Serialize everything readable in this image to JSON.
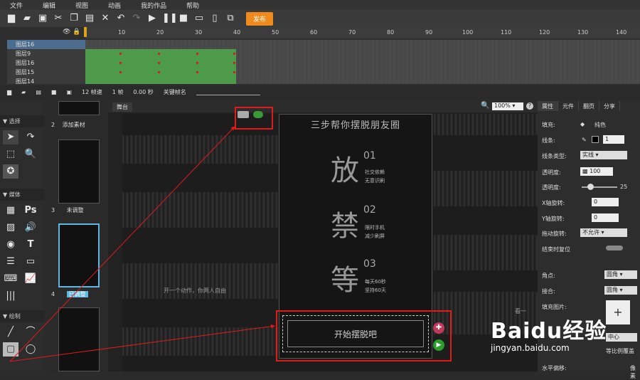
{
  "menu": [
    "文件",
    "编辑",
    "视图",
    "动画",
    "我的作品",
    "帮助"
  ],
  "toolbar": {
    "publish_label": "发布"
  },
  "timeline": {
    "ticks": [
      "10",
      "20",
      "30",
      "40",
      "50",
      "60",
      "70",
      "80",
      "90",
      "100",
      "110",
      "120",
      "130",
      "140"
    ],
    "layers": [
      "图层16",
      "图层9",
      "图层16",
      "图层15",
      "图层14"
    ],
    "fps": "12 帧速",
    "frame": "1 帧",
    "time": "0.00 秒",
    "keyframe_label": "关键帧名"
  },
  "tools": {
    "select_label": "选择",
    "media_label": "媒体",
    "draw_label": "绘制"
  },
  "pages": [
    {
      "num": "2",
      "label": "添加素材"
    },
    {
      "num": "3",
      "label": "未调整"
    },
    {
      "num": "4",
      "label": "已调整"
    }
  ],
  "canvas": {
    "tab": "舞台",
    "zoom": "100%",
    "phone_title": "三步帮你摆脱朋友圈",
    "items": [
      {
        "char": "放",
        "num": "01",
        "sub1": "社交依赖",
        "sub2": "无意识刷"
      },
      {
        "char": "禁",
        "num": "02",
        "sub1": "限时手机",
        "sub2": "减少刷屏"
      },
      {
        "char": "等",
        "num": "03",
        "sub1": "每天60秒",
        "sub2": "坚持60天"
      }
    ],
    "button_label": "开始摆脱吧",
    "side_text_1": "开一个动作，你两人自由",
    "side_text_2": "看一"
  },
  "props": {
    "tabs": [
      "属性",
      "元件",
      "翻页",
      "分享"
    ],
    "fill_label": "填充:",
    "fill_value": "纯色",
    "stroke_label": "线条:",
    "stroke_value": "1",
    "stroke_type_label": "线条类型:",
    "stroke_type_value": "实线",
    "opacity_label": "透明度:",
    "opacity_value": "100",
    "blur_label": "透明度:",
    "blur_value": "25",
    "x_rot_label": "X轴旋转:",
    "x_rot_value": "0",
    "y_rot_label": "Y轴旋转:",
    "y_rot_value": "0",
    "drag_rot_label": "拖动旋转:",
    "drag_rot_value": "不允许",
    "reset_label": "结束时复位",
    "corner_label": "角点:",
    "corner_value": "圆角",
    "join_label": "接合:",
    "join_value": "圆角",
    "fill_image_label": "填充图片:",
    "align_value": "中心",
    "scale_value": "等比例覆盖",
    "offset_label": "水平偏移:",
    "offset_value": "像素"
  },
  "watermark": {
    "brand": "Baidu经验",
    "url": "jingyan.baidu.com"
  },
  "colors": {
    "accent": "#f08a1c",
    "annotation": "#e01b1b",
    "keyframe_green": "#4c9a4a"
  }
}
